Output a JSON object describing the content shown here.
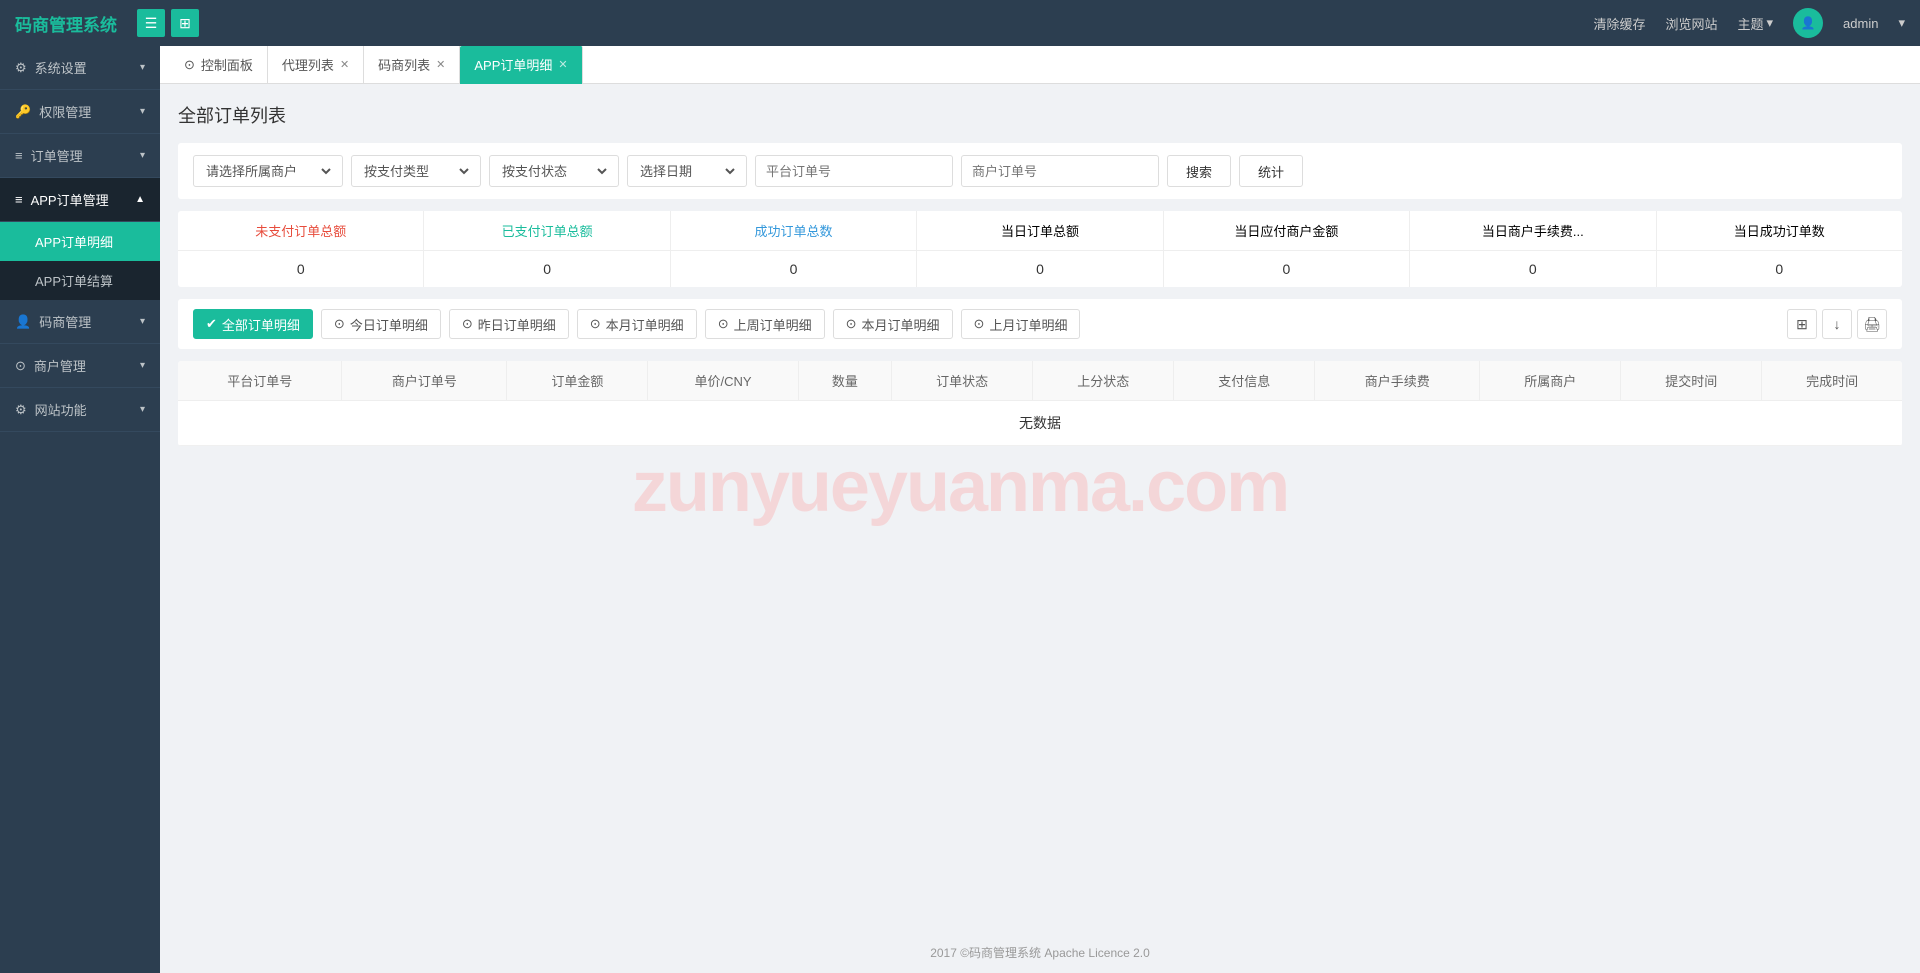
{
  "app": {
    "title": "码商管理系统",
    "watermark": "zunyueyuanma.com"
  },
  "topnav": {
    "logo": "码商管理系统",
    "icon_menu": "☰",
    "icon_grid": "⊞",
    "clear_cache": "清除缓存",
    "browse_site": "浏览网站",
    "theme": "主题",
    "admin": "admin"
  },
  "sidebar": {
    "items": [
      {
        "icon": "⚙",
        "label": "系统设置",
        "arrow": "▾",
        "active": false
      },
      {
        "icon": "🔑",
        "label": "权限管理",
        "arrow": "▾",
        "active": false
      },
      {
        "icon": "≡",
        "label": "订单管理",
        "arrow": "▾",
        "active": false
      },
      {
        "icon": "≡",
        "label": "APP订单管理",
        "arrow": "▲",
        "active": true
      },
      {
        "icon": "👤",
        "label": "码商管理",
        "arrow": "▾",
        "active": false
      },
      {
        "icon": "⊙",
        "label": "商户管理",
        "arrow": "▾",
        "active": false
      },
      {
        "icon": "⚙",
        "label": "网站功能",
        "arrow": "▾",
        "active": false
      }
    ],
    "submenu": [
      {
        "label": "APP订单明细",
        "active": true
      },
      {
        "label": "APP订单结算",
        "active": false
      }
    ]
  },
  "tabs": [
    {
      "label": "控制面板",
      "icon": "⊙",
      "closable": false,
      "active": false
    },
    {
      "label": "代理列表",
      "closable": true,
      "active": false
    },
    {
      "label": "码商列表",
      "closable": true,
      "active": false
    },
    {
      "label": "APP订单明细",
      "closable": true,
      "active": true
    }
  ],
  "page": {
    "title": "全部订单列表"
  },
  "filters": {
    "merchant_placeholder": "请选择所属商户",
    "payment_type_placeholder": "按支付类型",
    "payment_status_placeholder": "按支付状态",
    "date_placeholder": "选择日期",
    "platform_order_placeholder": "平台订单号",
    "merchant_order_placeholder": "商户订单号",
    "search_btn": "搜索",
    "stats_btn": "统计"
  },
  "stats": {
    "headers": [
      {
        "label": "未支付订单总额",
        "color": "red"
      },
      {
        "label": "已支付订单总额",
        "color": "green"
      },
      {
        "label": "成功订单总数",
        "color": "blue"
      },
      {
        "label": "当日订单总额",
        "color": "default"
      },
      {
        "label": "当日应付商户金额",
        "color": "default"
      },
      {
        "label": "当日商户手续费...",
        "color": "default"
      },
      {
        "label": "当日成功订单数",
        "color": "default"
      }
    ],
    "values": [
      "0",
      "0",
      "0",
      "0",
      "0",
      "0",
      "0"
    ]
  },
  "quick_filters": [
    {
      "label": "全部订单明细",
      "active": true
    },
    {
      "label": "今日订单明细",
      "active": false
    },
    {
      "label": "昨日订单明细",
      "active": false
    },
    {
      "label": "本月订单明细",
      "active": false
    },
    {
      "label": "上周订单明细",
      "active": false
    },
    {
      "label": "本月订单明细",
      "active": false
    },
    {
      "label": "上月订单明细",
      "active": false
    }
  ],
  "table": {
    "columns": [
      "平台订单号",
      "商户订单号",
      "订单金额",
      "单价/CNY",
      "数量",
      "订单状态",
      "上分状态",
      "支付信息",
      "商户手续费",
      "所属商户",
      "提交时间",
      "完成时间"
    ],
    "no_data": "无数据"
  },
  "footer": {
    "text": "2017 ©码商管理系统 Apache Licence 2.0"
  }
}
